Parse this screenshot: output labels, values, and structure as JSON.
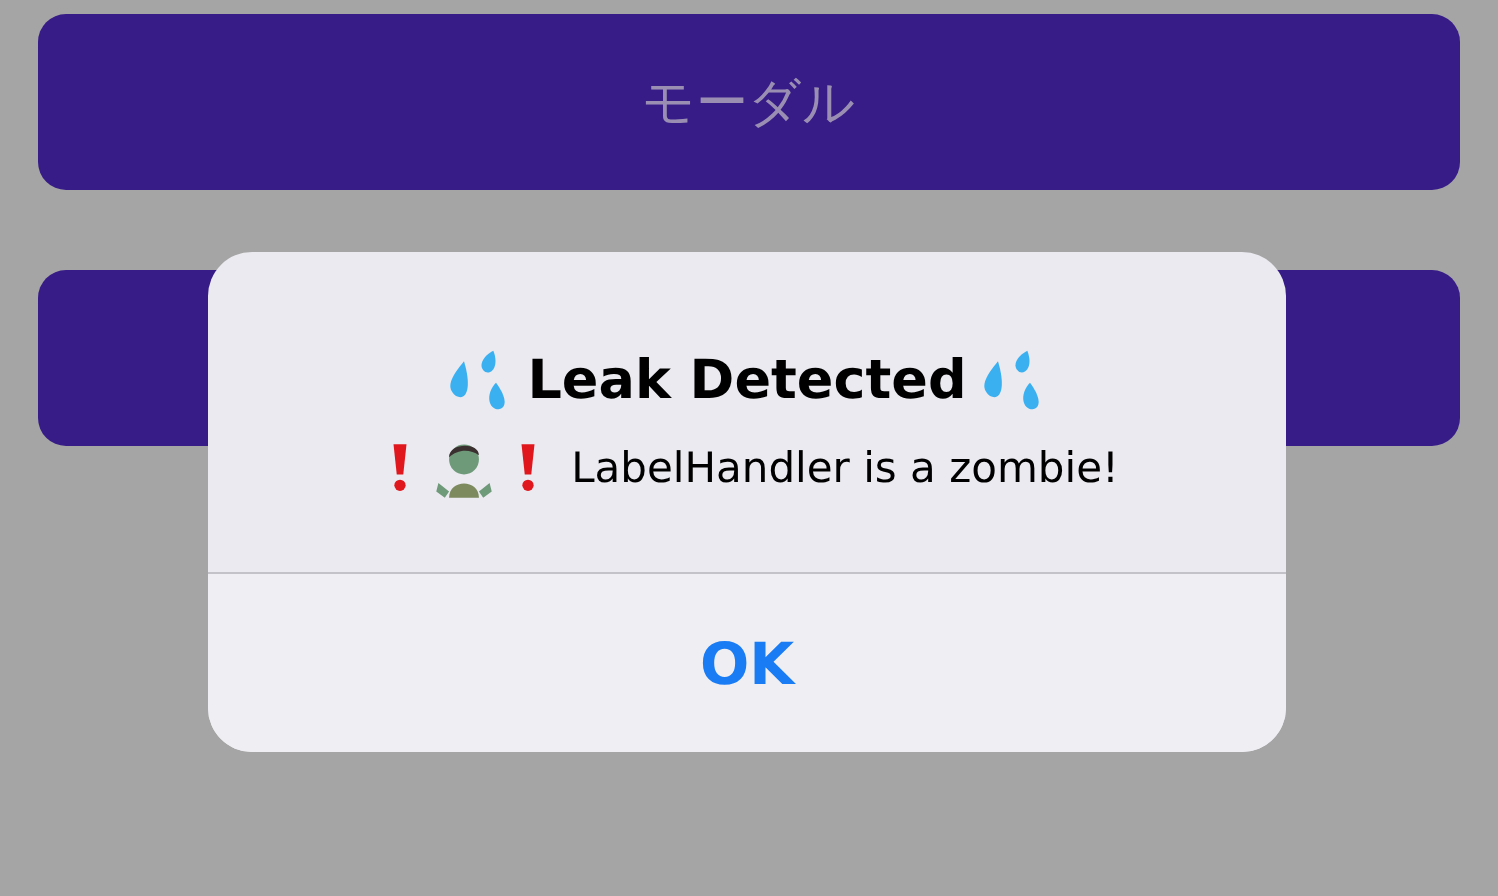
{
  "buttons": [
    {
      "label": "モーダル"
    }
  ],
  "alert": {
    "title": "Leak Detected",
    "message": "LabelHandler is a zombie!",
    "actions": [
      "OK"
    ]
  }
}
